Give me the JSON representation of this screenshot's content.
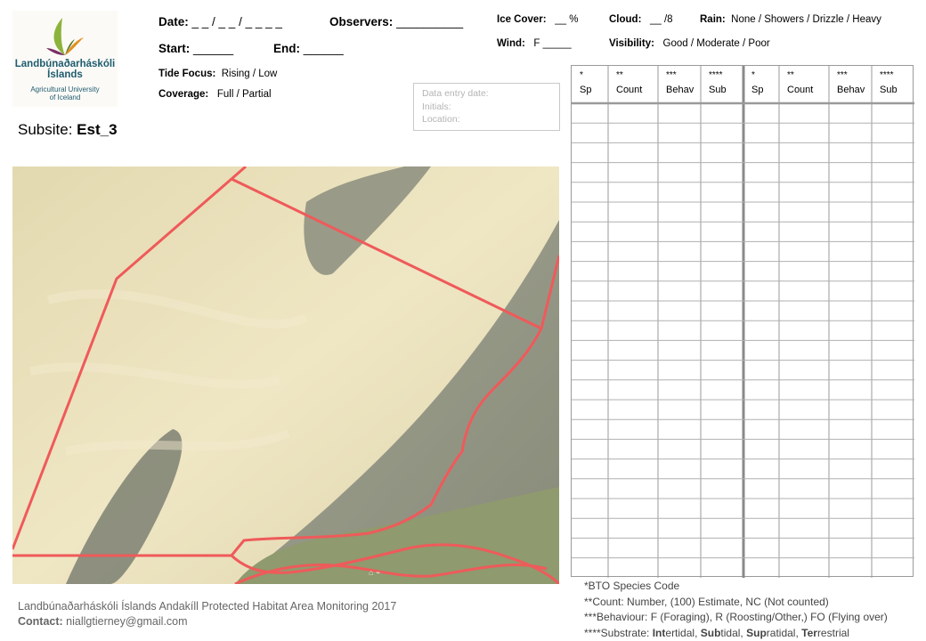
{
  "logo": {
    "name_line1": "Landbúnaðarháskóli",
    "name_line2": "Íslands",
    "sub_line1": "Agricultural University",
    "sub_line2": "of Iceland"
  },
  "subsite": {
    "label": "Subsite:",
    "value": "Est_3"
  },
  "header": {
    "date_label": "Date:",
    "date_value": "_ _  / _ _  / _ _ _ _",
    "observers_label": "Observers:",
    "observers_value": "__________",
    "start_label": "Start:",
    "start_value": "______",
    "end_label": "End:",
    "end_value": "______",
    "tide_label": "Tide Focus:",
    "tide_value": "Rising  /  Low",
    "coverage_label": "Coverage:",
    "coverage_value": "Full / Partial",
    "ice_label": "Ice Cover:",
    "ice_value": "__  %",
    "cloud_label": "Cloud:",
    "cloud_value": "__ /8",
    "rain_label": "Rain:",
    "rain_value": "None / Showers / Drizzle / Heavy",
    "wind_label": "Wind:",
    "wind_value": "F  _____",
    "visibility_label": "Visibility:",
    "visibility_value": "Good / Moderate / Poor"
  },
  "entry_box": {
    "line1": "Data entry date:",
    "line2": "Initials:",
    "line3": "Location:"
  },
  "table": {
    "columns": [
      {
        "stars": "*",
        "label": "Sp"
      },
      {
        "stars": "**",
        "label": "Count"
      },
      {
        "stars": "***",
        "label": "Behav"
      },
      {
        "stars": "****",
        "label": "Sub"
      },
      {
        "stars": "*",
        "label": "Sp"
      },
      {
        "stars": "**",
        "label": "Count"
      },
      {
        "stars": "***",
        "label": "Behav"
      },
      {
        "stars": "****",
        "label": "Sub"
      }
    ],
    "row_count": 24
  },
  "footer_left": {
    "line1": "Landbúnaðarháskóli Íslands Andakíll Protected Habitat Area Monitoring 2017",
    "contact_label": "Contact:",
    "contact_value": " niallgtierney@gmail.com"
  },
  "footer_right": {
    "line1": "*BTO Species Code",
    "line2": "**Count: Number, (100) Estimate, NC (Not counted)",
    "line3": "***Behaviour: F (Foraging), R (Roosting/Other,) FO (Flying over)",
    "line4_prefix": "****Substrate: ",
    "sub1_bold": "Int",
    "sub1_rest": "ertidal, ",
    "sub2_bold": "Sub",
    "sub2_rest": "tidal, ",
    "sub3_bold": "Sup",
    "sub3_rest": "ratidal, ",
    "sub4_bold": "Ter",
    "sub4_rest": "restrial"
  },
  "colors": {
    "boundary": "#ef5a5a",
    "sand": "#e6ddb6",
    "mud": "#8a8d80",
    "grass": "#8f9a6e",
    "logo_text": "#1f5c6e"
  }
}
